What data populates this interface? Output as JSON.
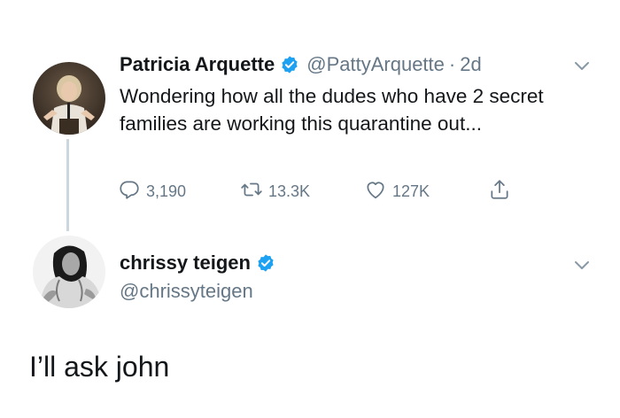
{
  "tweet1": {
    "display_name": "Patricia Arquette",
    "handle": "@PattyArquette",
    "separator": "·",
    "time": "2d",
    "text": "Wondering how all the dudes who have 2 secret families are working this quarantine out...",
    "verified": true,
    "avatar": "profile-photo-patricia-arquette",
    "actions": {
      "reply_count": "3,190",
      "retweet_count": "13.3K",
      "like_count": "127K",
      "share_icon": "share-icon"
    }
  },
  "tweet2": {
    "display_name": "chrissy teigen",
    "handle": "@chrissyteigen",
    "verified": true,
    "avatar": "profile-photo-chrissy-teigen",
    "text": "I’ll ask john"
  },
  "colors": {
    "text": "#14171a",
    "secondary": "#657786",
    "verified_blue": "#1da1f2",
    "thread_line": "#ccd6dd",
    "background": "#ffffff"
  }
}
